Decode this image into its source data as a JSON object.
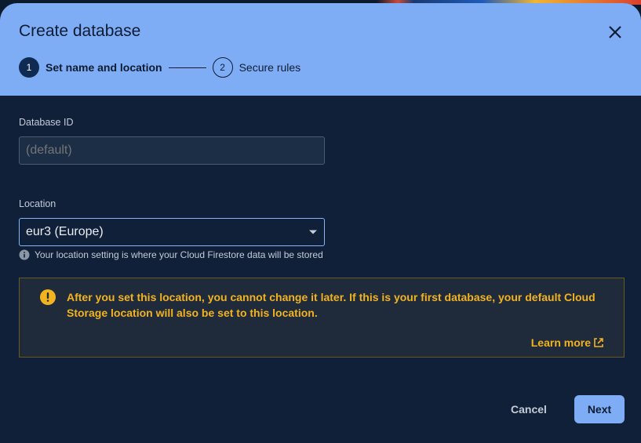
{
  "dialog": {
    "title": "Create database",
    "close_icon": "close-icon"
  },
  "stepper": {
    "steps": [
      {
        "number": "1",
        "label": "Set name and location",
        "active": true
      },
      {
        "number": "2",
        "label": "Secure rules",
        "active": false
      }
    ]
  },
  "form": {
    "database_id": {
      "label": "Database ID",
      "placeholder": "(default)",
      "value": ""
    },
    "location": {
      "label": "Location",
      "value": "eur3 (Europe)",
      "dropdown_icon": "dropdown-arrow-icon",
      "hint": "Your location setting is where your Cloud Firestore data will be stored",
      "hint_icon": "info-icon"
    }
  },
  "warning": {
    "icon": "warning-icon",
    "text": "After you set this location, you cannot change it later. If this is your first database, your default Cloud Storage location will also be set to this location.",
    "link_label": "Learn more",
    "link_icon": "external-link-icon"
  },
  "actions": {
    "cancel_label": "Cancel",
    "next_label": "Next"
  },
  "colors": {
    "header_bg": "#7fadf5",
    "dialog_bg": "#0f2038",
    "warning_text": "#f3b320",
    "accent": "#8ab4f8"
  }
}
